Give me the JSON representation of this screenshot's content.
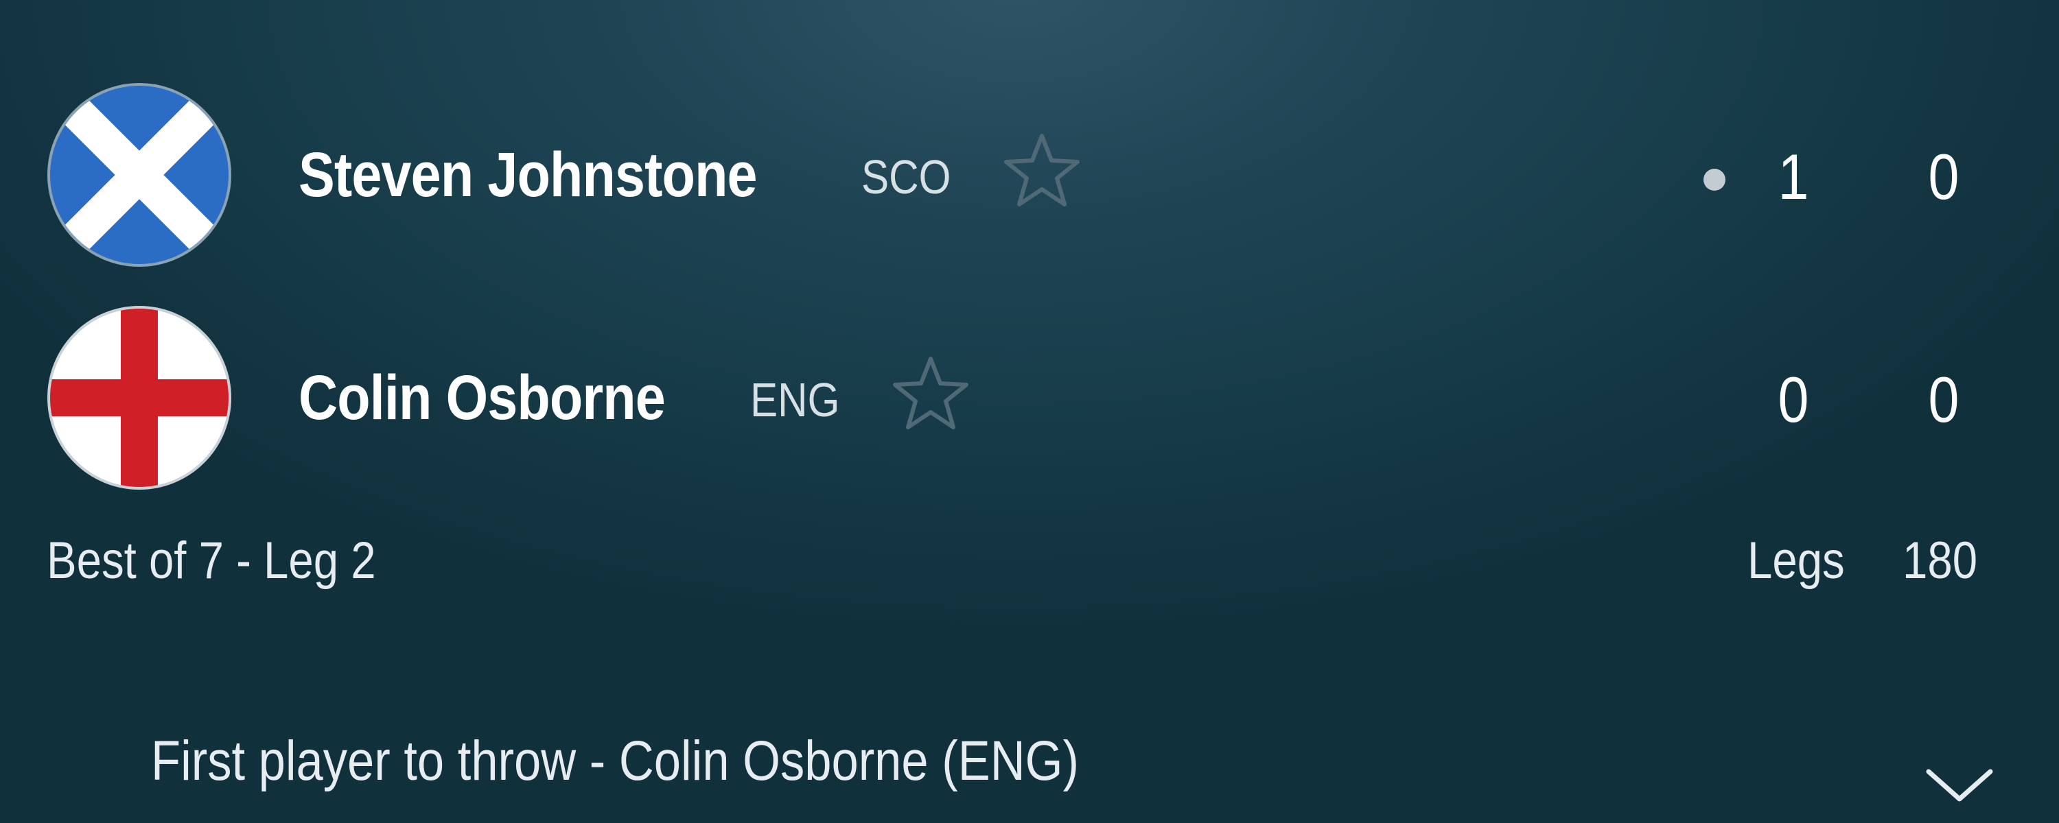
{
  "players": [
    {
      "name": "Steven Johnstone",
      "country_code": "SCO",
      "flag": "scotland-flag",
      "sets": "1",
      "legs": "0",
      "is_throwing": true,
      "favorite_icon": "star-outline-icon"
    },
    {
      "name": "Colin Osborne",
      "country_code": "ENG",
      "flag": "england-flag",
      "sets": "0",
      "legs": "0",
      "is_throwing": false,
      "favorite_icon": "star-outline-icon"
    }
  ],
  "match": {
    "format": "Best of 7 - Leg 2",
    "legs_label": "Legs",
    "stat_label": "180"
  },
  "first_thrower": {
    "text": "First player to throw - Colin Osborne (ENG)",
    "icon": "chevron-down-icon"
  },
  "colors": {
    "background": "#1f4555",
    "scotland_blue": "#2b6cc4",
    "england_red": "#cf2027",
    "star_outline": "#4f6a76"
  }
}
